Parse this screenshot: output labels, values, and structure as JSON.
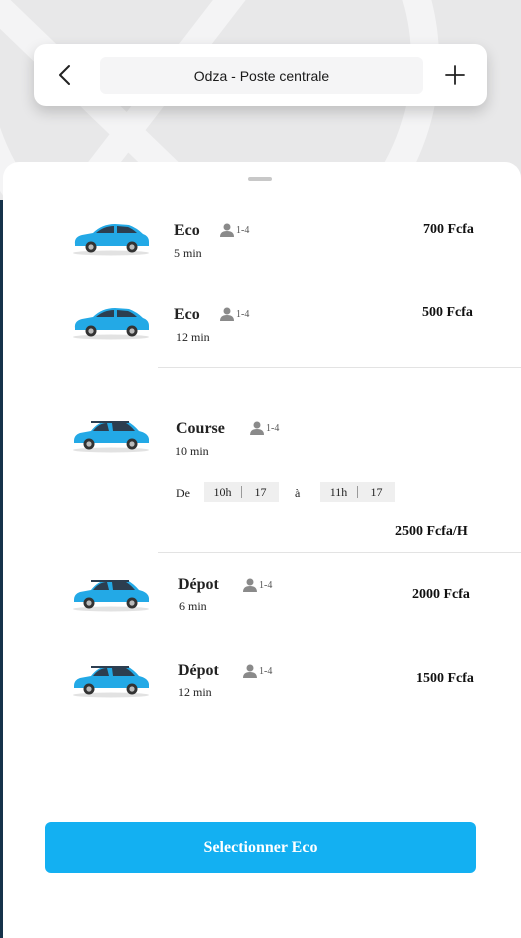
{
  "header": {
    "route": "Odza - Poste centrale"
  },
  "rides": [
    {
      "name": "Eco",
      "capacity": "1-4",
      "eta": "5 min",
      "price": "700 Fcfa"
    },
    {
      "name": "Eco",
      "capacity": "1-4",
      "eta": "12 min",
      "price": "500 Fcfa"
    },
    {
      "name": "Course",
      "capacity": "1-4",
      "eta": "10 min",
      "price": "2500 Fcfa/H",
      "schedule": {
        "from_label": "De",
        "from_hour": "10h",
        "from_minute": "17",
        "to_label": "à",
        "to_hour": "11h",
        "to_minute": "17"
      }
    },
    {
      "name": "Dépot",
      "capacity": "1-4",
      "eta": "6 min",
      "price": "2000 Fcfa"
    },
    {
      "name": "Dépot",
      "capacity": "1-4",
      "eta": "12 min",
      "price": "1500 Fcfa"
    }
  ],
  "action": {
    "select_label": "Selectionner Eco"
  },
  "colors": {
    "accent": "#13b0f2",
    "car_body": "#23a9e6"
  },
  "icons": {
    "back": "chevron-left-icon",
    "add": "plus-icon",
    "passenger": "person-icon",
    "vehicle": "car-icon"
  }
}
